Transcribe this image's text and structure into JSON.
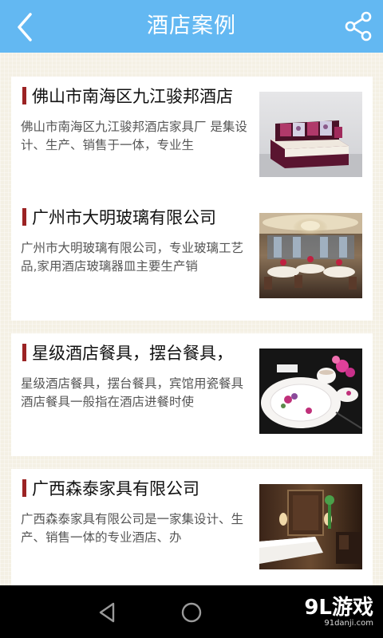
{
  "header": {
    "title": "酒店案例",
    "back_icon": "back-arrow-icon",
    "share_icon": "share-icon"
  },
  "cases": [
    {
      "title": "佛山市南海区九江骏邦酒店",
      "desc": "佛山市南海区九江骏邦酒店家具厂 是集设计、生产、销售于一体，专业生",
      "image": "sofa-photo"
    },
    {
      "title": "广州市大明玻璃有限公司",
      "desc": "广州市大明玻璃有限公司，专业玻璃工艺品,家用酒店玻璃器皿主要生产销",
      "image": "banquet-hall-photo"
    },
    {
      "title": "星级酒店餐具，摆台餐具，",
      "desc": "星级酒店餐具，摆台餐具，宾馆用瓷餐具酒店餐具一般指在酒店进餐时使",
      "image": "tableware-photo"
    },
    {
      "title": "广西森泰家具有限公司",
      "desc": "广西森泰家具有限公司是一家集设计、生产、销售一体的专业酒店、办",
      "image": "hotel-room-photo"
    }
  ],
  "navbar": {
    "back_icon": "nav-back-icon",
    "home_icon": "nav-home-icon",
    "brand_big": "9L游戏",
    "brand_small": "91danji.com"
  },
  "colors": {
    "header": "#63b8f2",
    "accent_bar": "#9b2324",
    "background": "#f3efe2"
  }
}
